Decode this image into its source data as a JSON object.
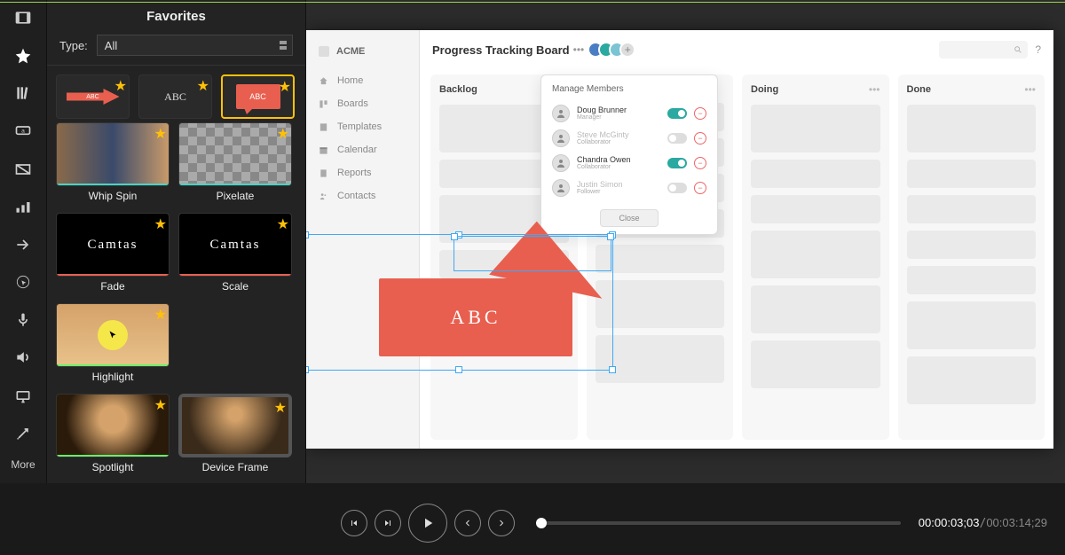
{
  "panel": {
    "title": "Favorites",
    "type_label": "Type:",
    "type_value": "All"
  },
  "thumbs": {
    "callout_arrow": "ABC",
    "callout_text": "ABC",
    "callout_speech": "ABC",
    "whip_spin": "Whip Spin",
    "pixelate": "Pixelate",
    "fade": "Fade",
    "fade_txt": "Camtas",
    "scale": "Scale",
    "scale_txt": "Camtas",
    "highlight": "Highlight",
    "spotlight": "Spotlight",
    "device_frame": "Device Frame"
  },
  "toolbar": {
    "more": "More"
  },
  "mock": {
    "brand": "ACME",
    "title": "Progress Tracking Board",
    "nav": {
      "home": "Home",
      "boards": "Boards",
      "templates": "Templates",
      "calendar": "Calendar",
      "reports": "Reports",
      "contacts": "Contacts"
    },
    "columns": {
      "backlog": "Backlog",
      "doing": "Doing",
      "done": "Done"
    },
    "popover": {
      "title": "Manage Members",
      "close": "Close",
      "members": [
        {
          "name": "Doug Brunner",
          "role": "Manager",
          "on": true,
          "dim": false
        },
        {
          "name": "Steve McGinty",
          "role": "Collaborator",
          "on": false,
          "dim": true
        },
        {
          "name": "Chandra Owen",
          "role": "Collaborator",
          "on": true,
          "dim": false
        },
        {
          "name": "Justin Simon",
          "role": "Follower",
          "on": false,
          "dim": true
        }
      ]
    },
    "callout_text": "ABC"
  },
  "playback": {
    "time_current": "00:00:03;03",
    "time_total": "00:03:14;29"
  }
}
